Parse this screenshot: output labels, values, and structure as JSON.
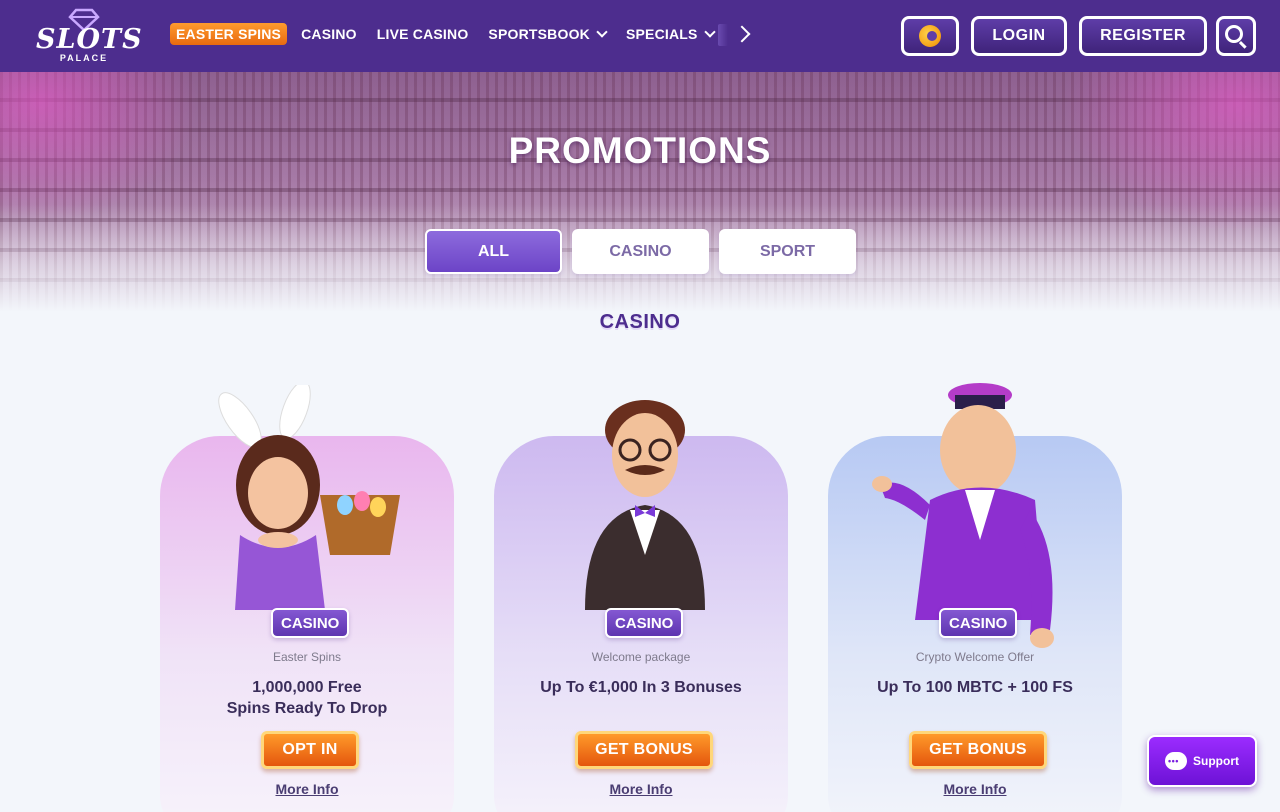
{
  "header": {
    "logo_text": "SLOTS",
    "logo_subtext": "PALACE",
    "nav": [
      {
        "label": "EASTER SPINS"
      },
      {
        "label": "CASINO"
      },
      {
        "label": "LIVE CASINO"
      },
      {
        "label": "SPORTSBOOK"
      },
      {
        "label": "SPECIALS"
      }
    ],
    "login_label": "LOGIN",
    "register_label": "REGISTER",
    "icons": {
      "coin": "coin-icon",
      "search": "search-icon",
      "next": "chevron-right-icon"
    }
  },
  "hero": {
    "title": "PROMOTIONS",
    "tabs": [
      {
        "label": "ALL",
        "active": true
      },
      {
        "label": "CASINO",
        "active": false
      },
      {
        "label": "SPORT",
        "active": false
      }
    ]
  },
  "section_title": "CASINO",
  "cards": [
    {
      "badge": "CASINO",
      "subtitle": "Easter Spins",
      "headline_line1": "1,000,000 Free",
      "headline_line2": "Spins Ready To Drop",
      "cta": "OPT IN",
      "more": "More Info"
    },
    {
      "badge": "CASINO",
      "subtitle": "Welcome package",
      "headline_line1": "Up To €1,000 In 3 Bonuses",
      "headline_line2": "",
      "cta": "GET BONUS",
      "more": "More Info"
    },
    {
      "badge": "CASINO",
      "subtitle": "Crypto Welcome Offer",
      "headline_line1": "Up To 100 MBTC + 100 FS",
      "headline_line2": "",
      "cta": "GET BONUS",
      "more": "More Info"
    }
  ],
  "support": {
    "label": "Support"
  },
  "colors": {
    "header": "#4d2d8e",
    "accent_orange": "#ff9a2a",
    "badge_purple": "#6c44c7",
    "support_purple": "#8a20f0"
  }
}
